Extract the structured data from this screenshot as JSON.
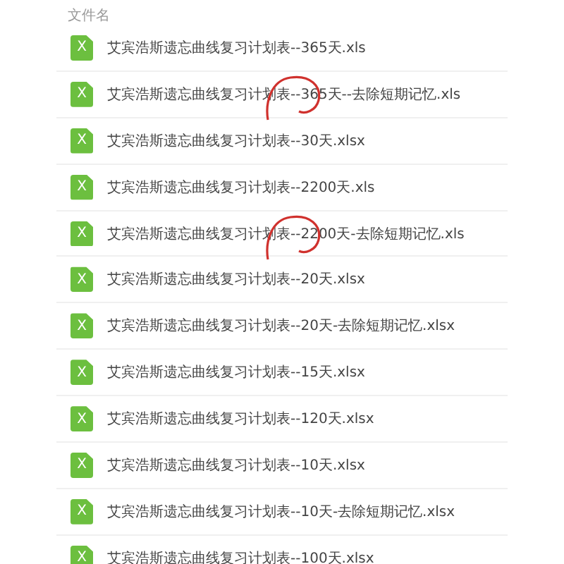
{
  "column_header": "文件名",
  "files": [
    {
      "icon_text": "X",
      "name": "艾宾浩斯遗忘曲线复习计划表--365天.xls",
      "circled": false
    },
    {
      "icon_text": "X",
      "name": "艾宾浩斯遗忘曲线复习计划表--365天--去除短期记忆.xls",
      "circled": true
    },
    {
      "icon_text": "X",
      "name": "艾宾浩斯遗忘曲线复习计划表--30天.xlsx",
      "circled": false
    },
    {
      "icon_text": "X",
      "name": "艾宾浩斯遗忘曲线复习计划表--2200天.xls",
      "circled": false
    },
    {
      "icon_text": "X",
      "name": "艾宾浩斯遗忘曲线复习计划表--2200天-去除短期记忆.xls",
      "circled": true
    },
    {
      "icon_text": "X",
      "name": "艾宾浩斯遗忘曲线复习计划表--20天.xlsx",
      "circled": false
    },
    {
      "icon_text": "X",
      "name": "艾宾浩斯遗忘曲线复习计划表--20天-去除短期记忆.xlsx",
      "circled": false
    },
    {
      "icon_text": "X",
      "name": "艾宾浩斯遗忘曲线复习计划表--15天.xlsx",
      "circled": false
    },
    {
      "icon_text": "X",
      "name": "艾宾浩斯遗忘曲线复习计划表--120天.xlsx",
      "circled": false
    },
    {
      "icon_text": "X",
      "name": "艾宾浩斯遗忘曲线复习计划表--10天.xlsx",
      "circled": false
    },
    {
      "icon_text": "X",
      "name": "艾宾浩斯遗忘曲线复习计划表--10天-去除短期记忆.xlsx",
      "circled": false
    },
    {
      "icon_text": "X",
      "name": "艾宾浩斯遗忘曲线复习计划表--100天.xlsx",
      "circled": false
    }
  ]
}
